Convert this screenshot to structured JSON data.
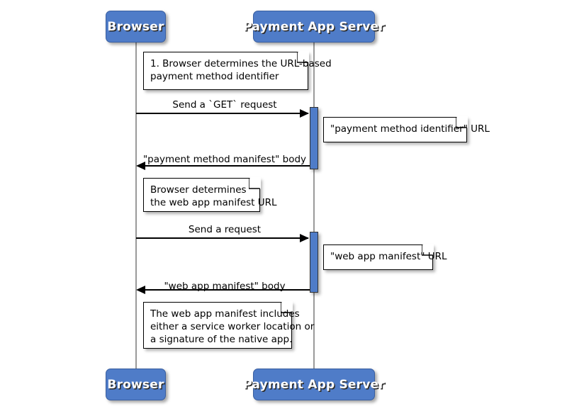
{
  "diagram": {
    "type": "sequence-diagram",
    "background_color": "#ffffff",
    "accent_color": "#4f7cc8",
    "line_color": "#000000",
    "lifeline_color": "#9a9a9a"
  },
  "participants": [
    {
      "id": "browser",
      "label": "Browser"
    },
    {
      "id": "payment_app_server",
      "label": "Payment App Server"
    }
  ],
  "participants_bottom": [
    {
      "id": "browser_bottom",
      "label": "Browser"
    },
    {
      "id": "payment_app_server_bottom",
      "label": "Payment App Server"
    }
  ],
  "messages": [
    {
      "id": "msg1",
      "label": "Send a `GET` request",
      "from": "browser",
      "to": "payment_app_server",
      "direction": "right"
    },
    {
      "id": "msg2",
      "label": "\"payment method manifest\" body",
      "from": "payment_app_server",
      "to": "browser",
      "direction": "left"
    },
    {
      "id": "msg3",
      "label": "Send a request",
      "from": "browser",
      "to": "payment_app_server",
      "direction": "right"
    },
    {
      "id": "msg4",
      "label": "\"web app manifest\" body",
      "from": "payment_app_server",
      "to": "browser",
      "direction": "left"
    }
  ],
  "notes": [
    {
      "id": "note1",
      "side": "over-browser",
      "lines": [
        "1. Browser determines the URL-based",
        "payment method identifier"
      ]
    },
    {
      "id": "note2",
      "side": "right-of-server",
      "lines": [
        "\"payment method identifier\" URL"
      ]
    },
    {
      "id": "note3",
      "side": "right-of-browser",
      "lines": [
        "Browser determines",
        "the web app manifest URL"
      ]
    },
    {
      "id": "note4",
      "side": "right-of-server",
      "lines": [
        "\"web app manifest\" URL"
      ]
    },
    {
      "id": "note5",
      "side": "right-of-browser",
      "lines": [
        "The web app manifest includes",
        "either a service worker location or",
        "a signature of the native app."
      ]
    }
  ]
}
